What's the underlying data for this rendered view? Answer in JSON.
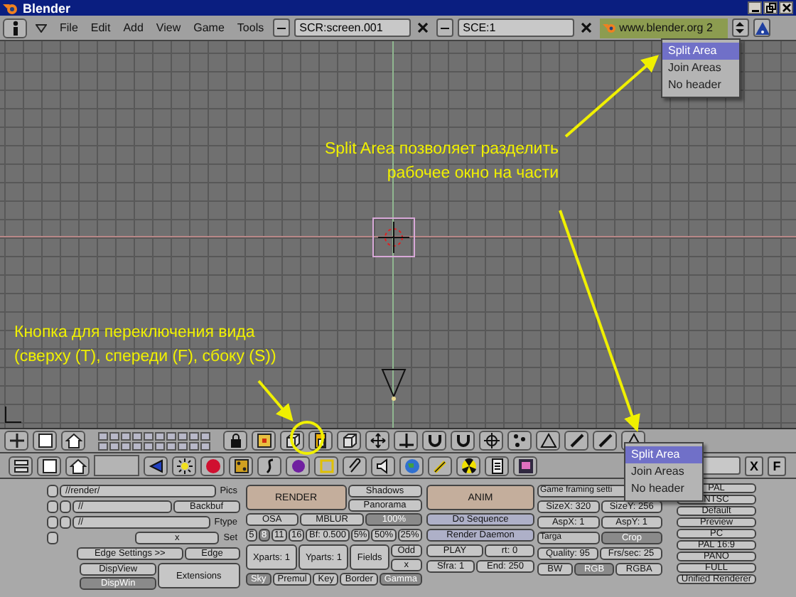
{
  "window": {
    "title": "Blender"
  },
  "menu_bar": {
    "menus": [
      "File",
      "Edit",
      "Add",
      "View",
      "Game",
      "Tools"
    ],
    "screen": "SCR:screen.001",
    "scene": "SCE:1",
    "url": "www.blender.org 2"
  },
  "annotations": [
    {
      "text": "Split Area позволяет разделить\nрабочее окно на части"
    },
    {
      "text": "Кнопка для переключения вида\n(сверху (T), спереди (F), сбоку (S))"
    }
  ],
  "area_menus": [
    {
      "items": [
        {
          "label": "Split Area",
          "selected": true
        },
        {
          "label": "Join Areas",
          "selected": false
        },
        {
          "label": "No header",
          "selected": false
        }
      ]
    },
    {
      "items": [
        {
          "label": "Split Area",
          "selected": true
        },
        {
          "label": "Join Areas",
          "selected": false
        },
        {
          "label": "No header",
          "selected": false
        }
      ]
    }
  ],
  "buttons_header": {
    "buttons": [
      "X",
      "F"
    ]
  },
  "render_panel": {
    "columns": [
      {
        "rows": [
          {
            "items": [
              {
                "kind": "blank"
              },
              {
                "kind": "field",
                "text": "//render/"
              },
              {
                "kind": "label",
                "text": "Pics"
              }
            ]
          },
          {
            "items": [
              {
                "kind": "blank"
              },
              {
                "kind": "blank"
              },
              {
                "kind": "field",
                "text": "//"
              },
              {
                "kind": "button",
                "text": "Backbuf"
              }
            ]
          },
          {
            "items": [
              {
                "kind": "blank"
              },
              {
                "kind": "blank"
              },
              {
                "kind": "field",
                "text": "//"
              },
              {
                "kind": "label",
                "text": "Ftype"
              }
            ]
          },
          {
            "items": [
              {
                "kind": "blank"
              },
              {
                "kind": "spacer"
              },
              {
                "kind": "button",
                "text": "x"
              },
              {
                "kind": "label",
                "text": "Set"
              }
            ]
          },
          {
            "items": [
              {
                "kind": "spacer"
              },
              {
                "kind": "button",
                "text": "Edge Settings >>"
              },
              {
                "kind": "button",
                "text": "Edge"
              }
            ]
          },
          {
            "items": [
              {
                "kind": "spacer"
              },
              {
                "kind": "stack",
                "items": [
                  {
                    "kind": "toggle",
                    "text": "DispView",
                    "selected": false
                  },
                  {
                    "kind": "toggle",
                    "text": "DispWin",
                    "selected": true
                  }
                ]
              },
              {
                "kind": "button",
                "text": "Extensions"
              }
            ]
          }
        ]
      },
      {
        "rows": [
          {
            "items": [
              {
                "kind": "big",
                "text": "RENDER"
              },
              {
                "kind": "stack",
                "items": [
                  {
                    "kind": "button",
                    "text": "Shadows"
                  },
                  {
                    "kind": "button",
                    "text": "Panorama"
                  }
                ]
              }
            ]
          },
          {
            "items": [
              {
                "kind": "button",
                "text": "OSA"
              },
              {
                "kind": "button",
                "text": "MBLUR"
              },
              {
                "kind": "toggle",
                "text": "100%",
                "selected": true
              }
            ]
          },
          {
            "items": [
              {
                "kind": "button",
                "text": "5"
              },
              {
                "kind": "toggle",
                "text": "8",
                "selected": true
              },
              {
                "kind": "button",
                "text": "11"
              },
              {
                "kind": "button",
                "text": "16"
              },
              {
                "kind": "button",
                "text": "Bf: 0.500"
              },
              {
                "kind": "button",
                "text": "5%"
              },
              {
                "kind": "button",
                "text": "50%"
              },
              {
                "kind": "button",
                "text": "25%"
              }
            ]
          },
          {
            "items": [
              {
                "kind": "button",
                "text": "Xparts: 1"
              },
              {
                "kind": "button",
                "text": "Yparts: 1"
              },
              {
                "kind": "button",
                "text": "Fields"
              },
              {
                "kind": "stack",
                "items": [
                  {
                    "kind": "button",
                    "text": "Odd"
                  },
                  {
                    "kind": "button",
                    "text": "x"
                  }
                ]
              }
            ]
          },
          {
            "items": [
              {
                "kind": "toggle",
                "text": "Sky",
                "selected": true
              },
              {
                "kind": "button",
                "text": "Premul"
              },
              {
                "kind": "button",
                "text": "Key"
              },
              {
                "kind": "button",
                "text": "Border"
              },
              {
                "kind": "toggle",
                "text": "Gamma",
                "selected": true
              }
            ]
          }
        ]
      },
      {
        "rows": [
          {
            "items": [
              {
                "kind": "big",
                "text": "ANIM"
              }
            ]
          },
          {
            "items": [
              {
                "kind": "blue",
                "text": "Do Sequence"
              }
            ]
          },
          {
            "items": [
              {
                "kind": "blue",
                "text": "Render Daemon"
              }
            ]
          },
          {
            "items": [
              {
                "kind": "button",
                "text": "PLAY"
              },
              {
                "kind": "button",
                "text": "rt: 0"
              }
            ]
          },
          {
            "items": [
              {
                "kind": "button",
                "text": "Sfra: 1"
              },
              {
                "kind": "button",
                "text": "End: 250"
              }
            ]
          }
        ]
      },
      {
        "rows": [
          {
            "items": [
              {
                "kind": "menu",
                "text": "Game framing setti"
              }
            ]
          },
          {
            "items": [
              {
                "kind": "button",
                "text": "SizeX: 320"
              },
              {
                "kind": "button",
                "text": "SizeY: 256"
              }
            ]
          },
          {
            "items": [
              {
                "kind": "button",
                "text": "AspX: 1"
              },
              {
                "kind": "button",
                "text": "AspY: 1"
              }
            ]
          },
          {
            "items": [
              {
                "kind": "menu",
                "text": "Targa"
              },
              {
                "kind": "toggle",
                "text": "Crop",
                "selected": true
              }
            ]
          },
          {
            "items": [
              {
                "kind": "button",
                "text": "Quality: 95"
              },
              {
                "kind": "button",
                "text": "Frs/sec: 25"
              }
            ]
          },
          {
            "items": [
              {
                "kind": "button",
                "text": "BW"
              },
              {
                "kind": "toggle",
                "text": "RGB",
                "selected": true
              },
              {
                "kind": "button",
                "text": "RGBA"
              }
            ]
          }
        ]
      },
      {
        "rows": [
          {
            "items": [
              {
                "kind": "button",
                "text": "PAL"
              }
            ]
          },
          {
            "items": [
              {
                "kind": "button",
                "text": "NTSC"
              }
            ]
          },
          {
            "items": [
              {
                "kind": "button",
                "text": "Default"
              }
            ]
          },
          {
            "items": [
              {
                "kind": "button",
                "text": "Preview"
              }
            ]
          },
          {
            "items": [
              {
                "kind": "button",
                "text": "PC"
              }
            ]
          },
          {
            "items": [
              {
                "kind": "button",
                "text": "PAL 16:9"
              }
            ]
          },
          {
            "items": [
              {
                "kind": "button",
                "text": "PANO"
              }
            ]
          },
          {
            "items": [
              {
                "kind": "button",
                "text": "FULL"
              }
            ]
          },
          {
            "items": [
              {
                "kind": "button",
                "text": "Unified Renderer"
              }
            ]
          }
        ]
      }
    ]
  }
}
